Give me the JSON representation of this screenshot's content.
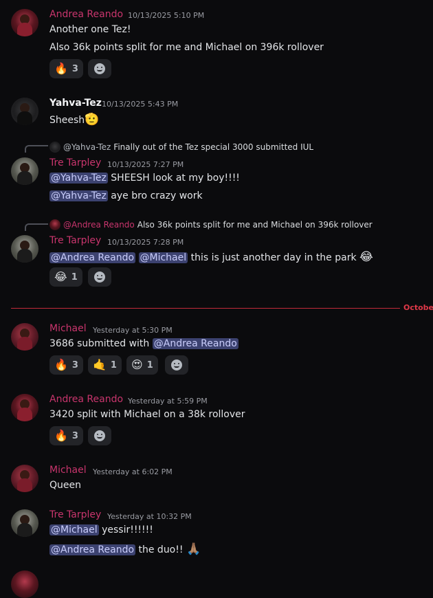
{
  "messages": [
    {
      "author": "Andrea Reando",
      "timestamp": "10/13/2025 5:10 PM",
      "lines": [
        "Another one Tez!",
        "Also 36k points split for me and Michael on 396k rollover"
      ],
      "reactions": [
        {
          "emoji": "🔥",
          "count": "3"
        }
      ]
    },
    {
      "author": "Yahva-Tez",
      "timestamp": "10/13/2025 5:43 PM",
      "text": "Sheesh",
      "emoji": "🫡"
    },
    {
      "reply": {
        "mention": "@Yahva-Tez",
        "text": "Finally out of the Tez special 3000 submitted IUL"
      },
      "author": "Tre Tarpley",
      "timestamp": "10/13/2025 7:27 PM",
      "line1": {
        "mention": "@Yahva-Tez",
        "text": "SHEESH look at my boy!!!!"
      },
      "line2": {
        "mention": "@Yahva-Tez",
        "text": "aye bro crazy work"
      }
    },
    {
      "reply": {
        "mention": "@Andrea Reando",
        "text": "Also 36k points split for me and Michael on 396k rollover"
      },
      "author": "Tre Tarpley",
      "timestamp": "10/13/2025 7:28 PM",
      "mention1": "@Andrea Reando",
      "mention2": "@Michael",
      "text": "this is just another day in the park",
      "emoji": "😂",
      "reactions": [
        {
          "emoji": "😂",
          "count": "1"
        }
      ]
    },
    {
      "author": "Michael",
      "timestamp": "Yesterday at 5:30 PM",
      "text": "3686 submitted with",
      "mention": "@Andrea Reando",
      "reactions": [
        {
          "emoji": "🔥",
          "count": "3"
        },
        {
          "emoji": "🤙",
          "count": "1"
        },
        {
          "emoji": "😍",
          "count": "1"
        }
      ]
    },
    {
      "author": "Andrea Reando",
      "timestamp": "Yesterday at 5:59 PM",
      "text": "3420 split with Michael on a 38k rollover",
      "reactions": [
        {
          "emoji": "🔥",
          "count": "3"
        }
      ]
    },
    {
      "author": "Michael",
      "timestamp": "Yesterday at 6:02 PM",
      "text": "Queen"
    },
    {
      "author": "Tre Tarpley",
      "timestamp": "Yesterday at 10:32 PM",
      "line1": {
        "mention": "@Michael",
        "text": "yessir!!!!!!"
      },
      "line2": {
        "mention": "@Andrea Reando",
        "text": "the duo!!",
        "emoji": "🙏🏽"
      }
    }
  ],
  "divider": {
    "label": "October",
    "color": "#c42b3a"
  },
  "colors": {
    "background": "#0b0b0d",
    "name_pink": "#c9356d",
    "mention_bg": "#3c4270"
  },
  "icons": {
    "add_reaction": "smiley-face-icon"
  }
}
